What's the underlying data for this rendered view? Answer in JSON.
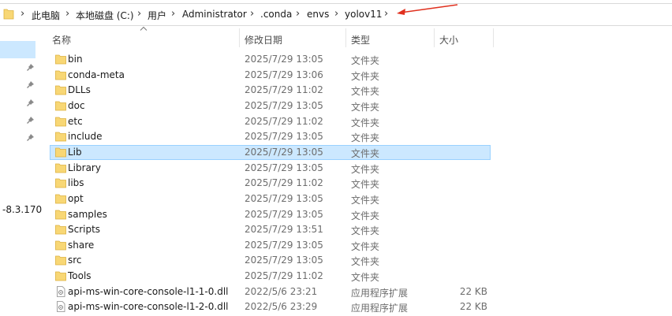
{
  "breadcrumb": [
    "此电脑",
    "本地磁盘 (C:)",
    "用户",
    "Administrator",
    ".conda",
    "envs",
    "yolov11"
  ],
  "columns": {
    "name": "名称",
    "modified": "修改日期",
    "type": "类型",
    "size": "大小"
  },
  "nav": {
    "partial_item": "-8.3.170"
  },
  "colors": {
    "selection": "#cce8ff",
    "selection_border": "#99d1ff",
    "folder": "#f8d775",
    "annotation_arrow": "#e0301e"
  },
  "files": [
    {
      "name": "bin",
      "modified": "2025/7/29 13:05",
      "type": "文件夹",
      "size": "",
      "icon": "folder-icon"
    },
    {
      "name": "conda-meta",
      "modified": "2025/7/29 13:06",
      "type": "文件夹",
      "size": "",
      "icon": "folder-icon"
    },
    {
      "name": "DLLs",
      "modified": "2025/7/29 11:02",
      "type": "文件夹",
      "size": "",
      "icon": "folder-icon"
    },
    {
      "name": "doc",
      "modified": "2025/7/29 13:05",
      "type": "文件夹",
      "size": "",
      "icon": "folder-icon"
    },
    {
      "name": "etc",
      "modified": "2025/7/29 11:02",
      "type": "文件夹",
      "size": "",
      "icon": "folder-icon"
    },
    {
      "name": "include",
      "modified": "2025/7/29 13:05",
      "type": "文件夹",
      "size": "",
      "icon": "folder-icon"
    },
    {
      "name": "Lib",
      "modified": "2025/7/29 13:05",
      "type": "文件夹",
      "size": "",
      "icon": "folder-icon",
      "selected": true
    },
    {
      "name": "Library",
      "modified": "2025/7/29 13:05",
      "type": "文件夹",
      "size": "",
      "icon": "folder-icon"
    },
    {
      "name": "libs",
      "modified": "2025/7/29 11:02",
      "type": "文件夹",
      "size": "",
      "icon": "folder-icon"
    },
    {
      "name": "opt",
      "modified": "2025/7/29 13:05",
      "type": "文件夹",
      "size": "",
      "icon": "folder-icon"
    },
    {
      "name": "samples",
      "modified": "2025/7/29 13:05",
      "type": "文件夹",
      "size": "",
      "icon": "folder-icon"
    },
    {
      "name": "Scripts",
      "modified": "2025/7/29 13:51",
      "type": "文件夹",
      "size": "",
      "icon": "folder-icon"
    },
    {
      "name": "share",
      "modified": "2025/7/29 13:05",
      "type": "文件夹",
      "size": "",
      "icon": "folder-icon"
    },
    {
      "name": "src",
      "modified": "2025/7/29 13:05",
      "type": "文件夹",
      "size": "",
      "icon": "folder-icon"
    },
    {
      "name": "Tools",
      "modified": "2025/7/29 11:02",
      "type": "文件夹",
      "size": "",
      "icon": "folder-icon"
    },
    {
      "name": "api-ms-win-core-console-l1-1-0.dll",
      "modified": "2022/5/6 23:21",
      "type": "应用程序扩展",
      "size": "22 KB",
      "icon": "dll-file-icon"
    },
    {
      "name": "api-ms-win-core-console-l1-2-0.dll",
      "modified": "2022/5/6 23:29",
      "type": "应用程序扩展",
      "size": "22 KB",
      "icon": "dll-file-icon"
    }
  ]
}
